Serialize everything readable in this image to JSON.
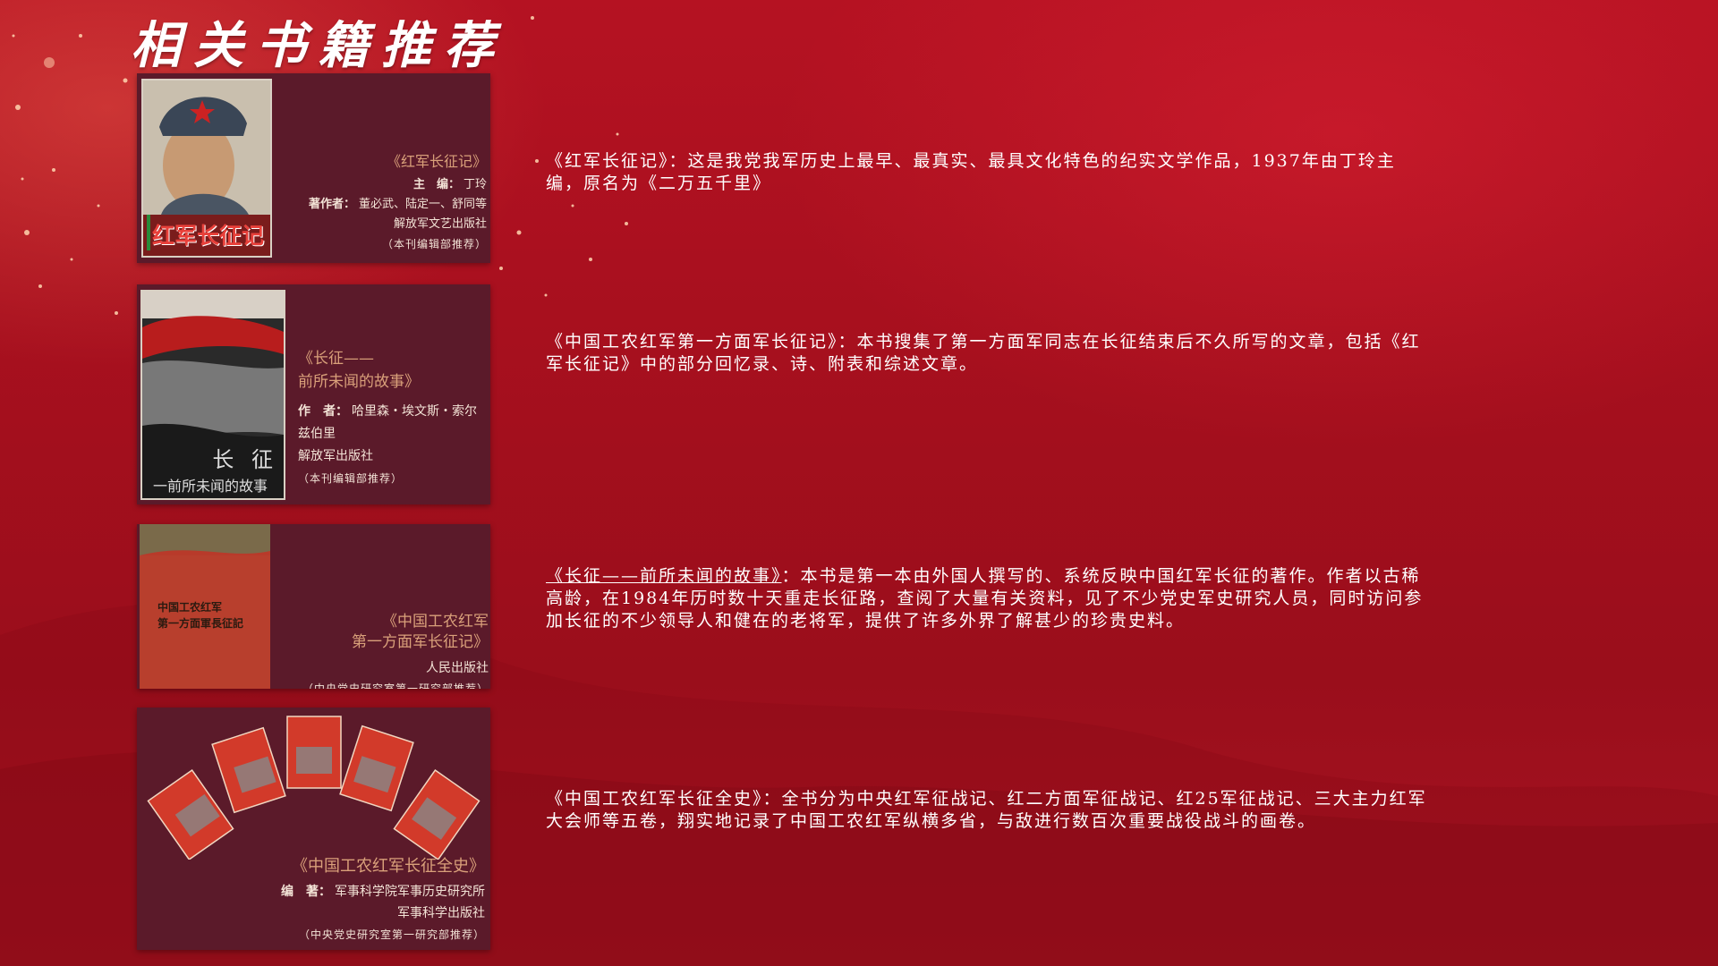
{
  "page": {
    "title": "相关书籍推荐"
  },
  "books": [
    {
      "name": "《红军长征记》",
      "editor_label": "主　编：",
      "editor": "丁玲",
      "authors_label": "著作者：",
      "authors": "董必武、陆定一、舒同等",
      "publisher": "解放军文艺出版社",
      "recommendation": "（本刊编辑部推荐）",
      "cover_title": "红军长征记",
      "description": "《红军长征记》：这是我党我军历史上最早、最真实、最具文化特色的纪实文学作品，1937年由丁玲主编，原名为《二万五千里》"
    },
    {
      "name_line1": "《长征——",
      "name_line2": "前所未闻的故事》",
      "author_label": "作　者：",
      "author": "哈里森・埃文斯・索尔兹伯里",
      "publisher": "解放军出版社",
      "recommendation": "（本刊编辑部推荐）",
      "cover_title": "长 征",
      "cover_subtitle": "一前所未闻的故事",
      "description_underlined": "《长征——前所未闻的故事》",
      "description_rest": "：本书是第一本由外国人撰写的、系统反映中国红军长征的著作。作者以古稀高龄，在1984年历时数十天重走长征路，查阅了大量有关资料，见了不少党史军史研究人员，同时访问参加长征的不少领导人和健在的老将军，提供了许多外界了解甚少的珍贵史料。"
    },
    {
      "name_line1": "《中国工农红军",
      "name_line2": "第一方面军长征记》",
      "publisher": "人民出版社",
      "recommendation": "（中央党史研究室第一研究部推荐）",
      "cover_title_line1": "中国工农红军",
      "cover_title_line2": "第一方面軍長征記",
      "description": "《中国工农红军第一方面军长征记》：本书搜集了第一方面军同志在长征结束后不久所写的文章，包括《红军长征记》中的部分回忆录、诗、附表和综述文章。"
    },
    {
      "name": "《中国工农红军长征全史》",
      "editor_label": "编　著：",
      "editor": "军事科学院军事历史研究所",
      "publisher": "军事科学出版社",
      "recommendation": "（中央党史研究室第一研究部推荐）",
      "description": "《中国工农红军长征全史》：全书分为中央红军征战记、红二方面军征战记、红25军征战记、三大主力红军大会师等五卷，翔实地记录了中国工农红军纵横多省，与敌进行数百次重要战役战斗的画卷。"
    }
  ],
  "colors": {
    "background": "#a30f1d",
    "card": "#5b1a2a",
    "accent": "#d9a07a"
  }
}
